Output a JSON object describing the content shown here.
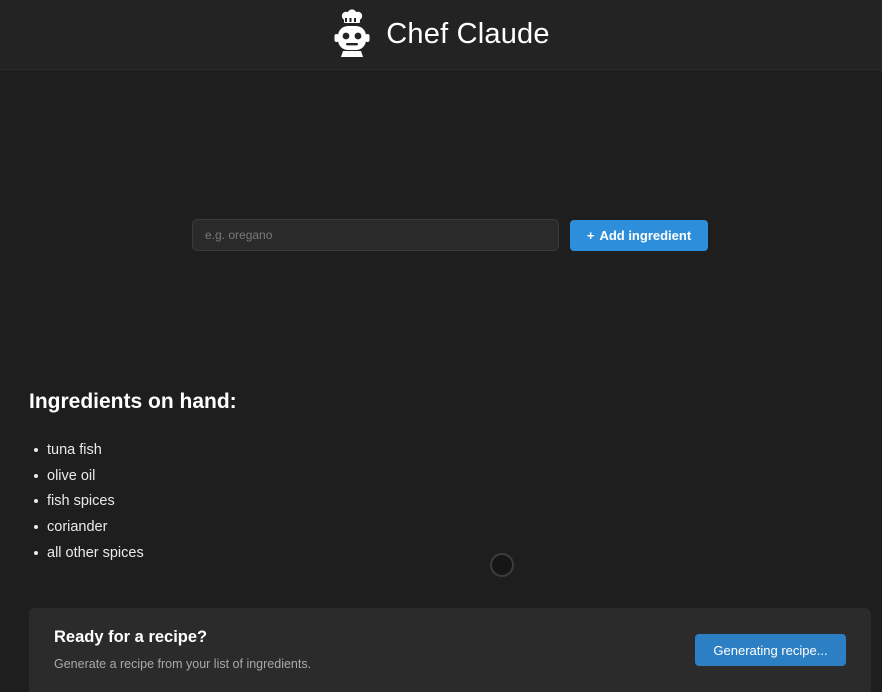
{
  "header": {
    "title": "Chef Claude",
    "logo_icon": "chef-robot-icon"
  },
  "form": {
    "placeholder": "e.g. oregano",
    "value": "",
    "add_button": {
      "icon": "+",
      "label": "Add ingredient"
    }
  },
  "ingredients": {
    "title": "Ingredients on hand:",
    "items": [
      "tuna fish",
      "olive oil",
      "fish spices",
      "coriander",
      "all other spices"
    ]
  },
  "recipe_panel": {
    "heading": "Ready for a recipe?",
    "subtext": "Generate a recipe from your list of ingredients.",
    "button_label": "Generating recipe..."
  },
  "colors": {
    "background": "#1e1e1f",
    "header": "#232324",
    "accent": "#2d8fdc",
    "panel": "#2b2b2c"
  }
}
